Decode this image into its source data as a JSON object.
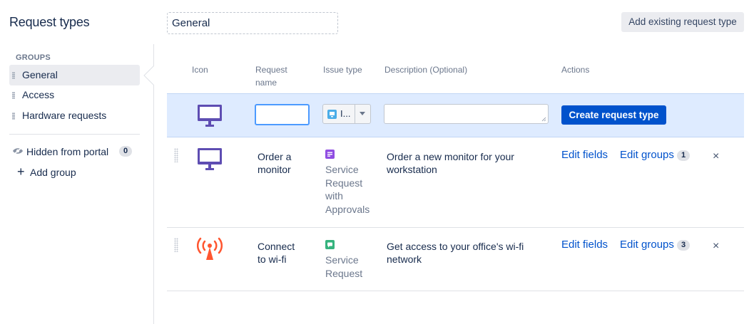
{
  "header": {
    "title": "Request types",
    "group_name": "General",
    "add_existing_label": "Add existing request type"
  },
  "sidebar": {
    "groups_heading": "GROUPS",
    "items": [
      {
        "label": "General",
        "active": true
      },
      {
        "label": "Access",
        "active": false
      },
      {
        "label": "Hardware requests",
        "active": false
      }
    ],
    "hidden_label": "Hidden from portal",
    "hidden_count": "0",
    "add_group_label": "Add group"
  },
  "table": {
    "headers": {
      "icon": "Icon",
      "request_name_line1": "Request",
      "request_name_line2": "name",
      "issue_type": "Issue type",
      "description": "Description",
      "description_optional": "(Optional)",
      "actions": "Actions"
    },
    "new_row": {
      "issue_type_value": "I...",
      "create_label": "Create request type"
    },
    "rows": [
      {
        "name_line1": "Order a",
        "name_line2": "monitor",
        "issue_type_lines": [
          "Service",
          "Request",
          "with",
          "Approvals"
        ],
        "description_line1": "Order a new monitor for your",
        "description_line2": "workstation",
        "edit_fields": "Edit fields",
        "edit_groups": "Edit groups",
        "groups_count": "1",
        "icon": "monitor-icon",
        "issue_icon": "approval-icon"
      },
      {
        "name_line1": "Connect",
        "name_line2": "to wi-fi",
        "issue_type_lines": [
          "Service",
          "Request"
        ],
        "description_line1": "Get access to your office's wi-fi",
        "description_line2": "network",
        "edit_fields": "Edit fields",
        "edit_groups": "Edit groups",
        "groups_count": "3",
        "icon": "wifi-antenna-icon",
        "issue_icon": "service-request-icon"
      }
    ],
    "remove_symbol": "×"
  },
  "colors": {
    "primary": "#0052cc",
    "monitor_purple": "#5e4db2",
    "wifi_orange": "#ff5630",
    "approval_purple": "#904ee2",
    "service_green": "#36b37e"
  }
}
